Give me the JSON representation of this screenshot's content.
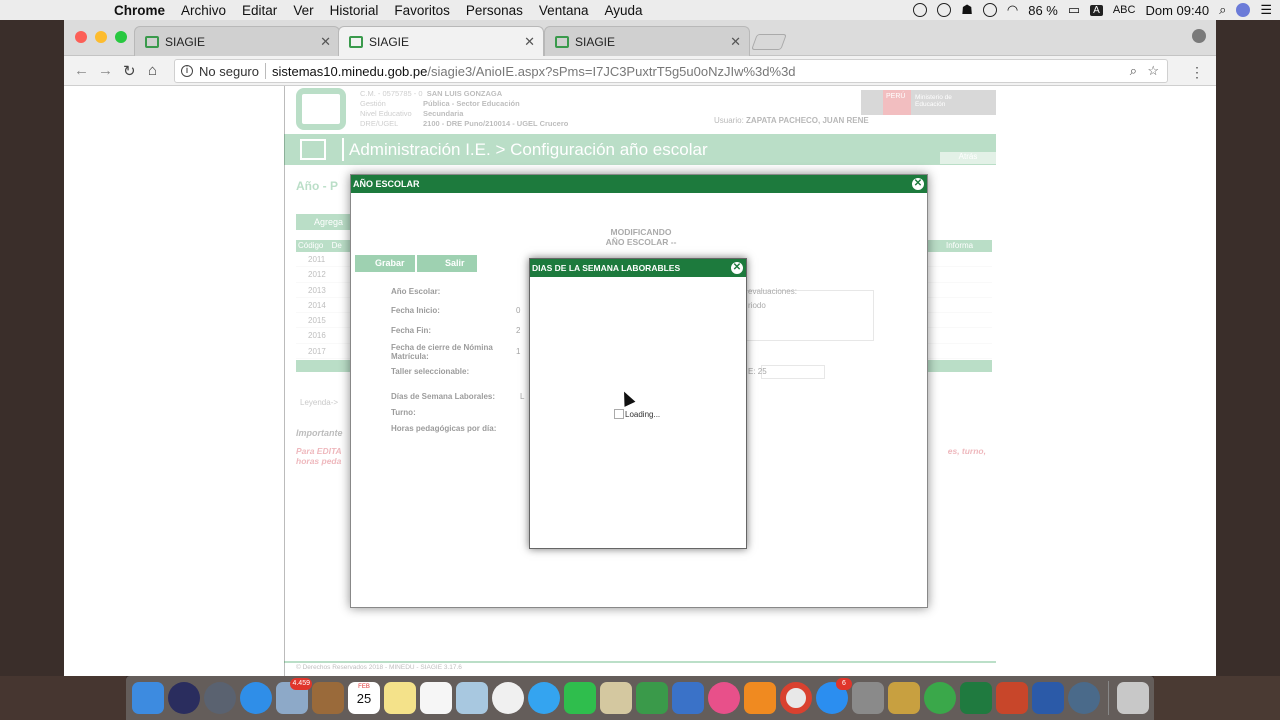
{
  "menubar": {
    "app": "Chrome",
    "items": [
      "Archivo",
      "Editar",
      "Ver",
      "Historial",
      "Favoritos",
      "Personas",
      "Ventana",
      "Ayuda"
    ],
    "battery": "86 %",
    "input": "ABC",
    "clock": "Dom 09:40"
  },
  "browser": {
    "tabs": [
      {
        "title": "SIAGIE"
      },
      {
        "title": "SIAGIE"
      },
      {
        "title": "SIAGIE"
      }
    ],
    "security": "No seguro",
    "url_host": "sistemas10.minedu.gob.pe",
    "url_path": "/siagie3/AnioIE.aspx?sPms=I7JC3PuxtrT5g5u0oNzJIw%3d%3d"
  },
  "header": {
    "cm": "C.M. - 0575785 - 0",
    "school": "SAN LUIS GONZAGA",
    "gestion_label": "Gestión",
    "gestion": "Pública - Sector Educación",
    "nivel_label": "Nivel Educativo",
    "nivel": "Secundaria",
    "dre_label": "DRE/UGEL",
    "dre": "2100 - DRE Puno/210014 - UGEL Crucero",
    "peru": "PERÚ",
    "ministerio": "Ministerio de Educación",
    "usuario_label": "Usuario:",
    "usuario": "ZAPATA PACHECO, JUAN RENE",
    "title": "Administración I.E. > Configuración año escolar",
    "atras": "Atrás"
  },
  "page": {
    "section_title": "Año - P",
    "agregar": "Agrega",
    "grid_headers": [
      "Código",
      "De",
      "Informa"
    ],
    "years": [
      "2011",
      "2012",
      "2013",
      "2014",
      "2015",
      "2016",
      "2017"
    ],
    "leyenda": "Leyenda->",
    "importante": "Importante",
    "para_editar": "Para EDITA",
    "para_editar_2": "horas peda",
    "para_editar_right": "es, turno,",
    "footer": "© Derechos Reservados 2018 - MINEDU - SIAGIE 3.17.6"
  },
  "modal_anio": {
    "title": "AÑO ESCOLAR",
    "heading_1": "MODIFICANDO",
    "heading_2": "AÑO ESCOLAR --",
    "grabar": "Grabar",
    "salir": "Salir",
    "labels": {
      "anio": "Año Escolar:",
      "inicio": "Fecha Inicio:",
      "fin": "Fecha Fin:",
      "cierre": "Fecha de cierre de Nómina Matrícula:",
      "taller": "Taller seleccionable:",
      "dias": "Días de Semana Laborales:",
      "turno": "Turno:",
      "horas": "Horas pedagógicas por día:"
    },
    "values": {
      "inicio": "0",
      "fin": "2",
      "cierre": "1",
      "dias": "L"
    },
    "evaluaciones": "evaluaciones:",
    "periodo": "riodo",
    "ie_label": "E:",
    "ie_value": "25"
  },
  "modal_dias": {
    "title": "DIAS DE LA SEMANA LABORABLES",
    "loading": "Loading..."
  },
  "dock": {
    "badges": {
      "mail": "4.459",
      "calendar_day": "25",
      "calendar_month": "FEB",
      "appstore": "6"
    }
  }
}
